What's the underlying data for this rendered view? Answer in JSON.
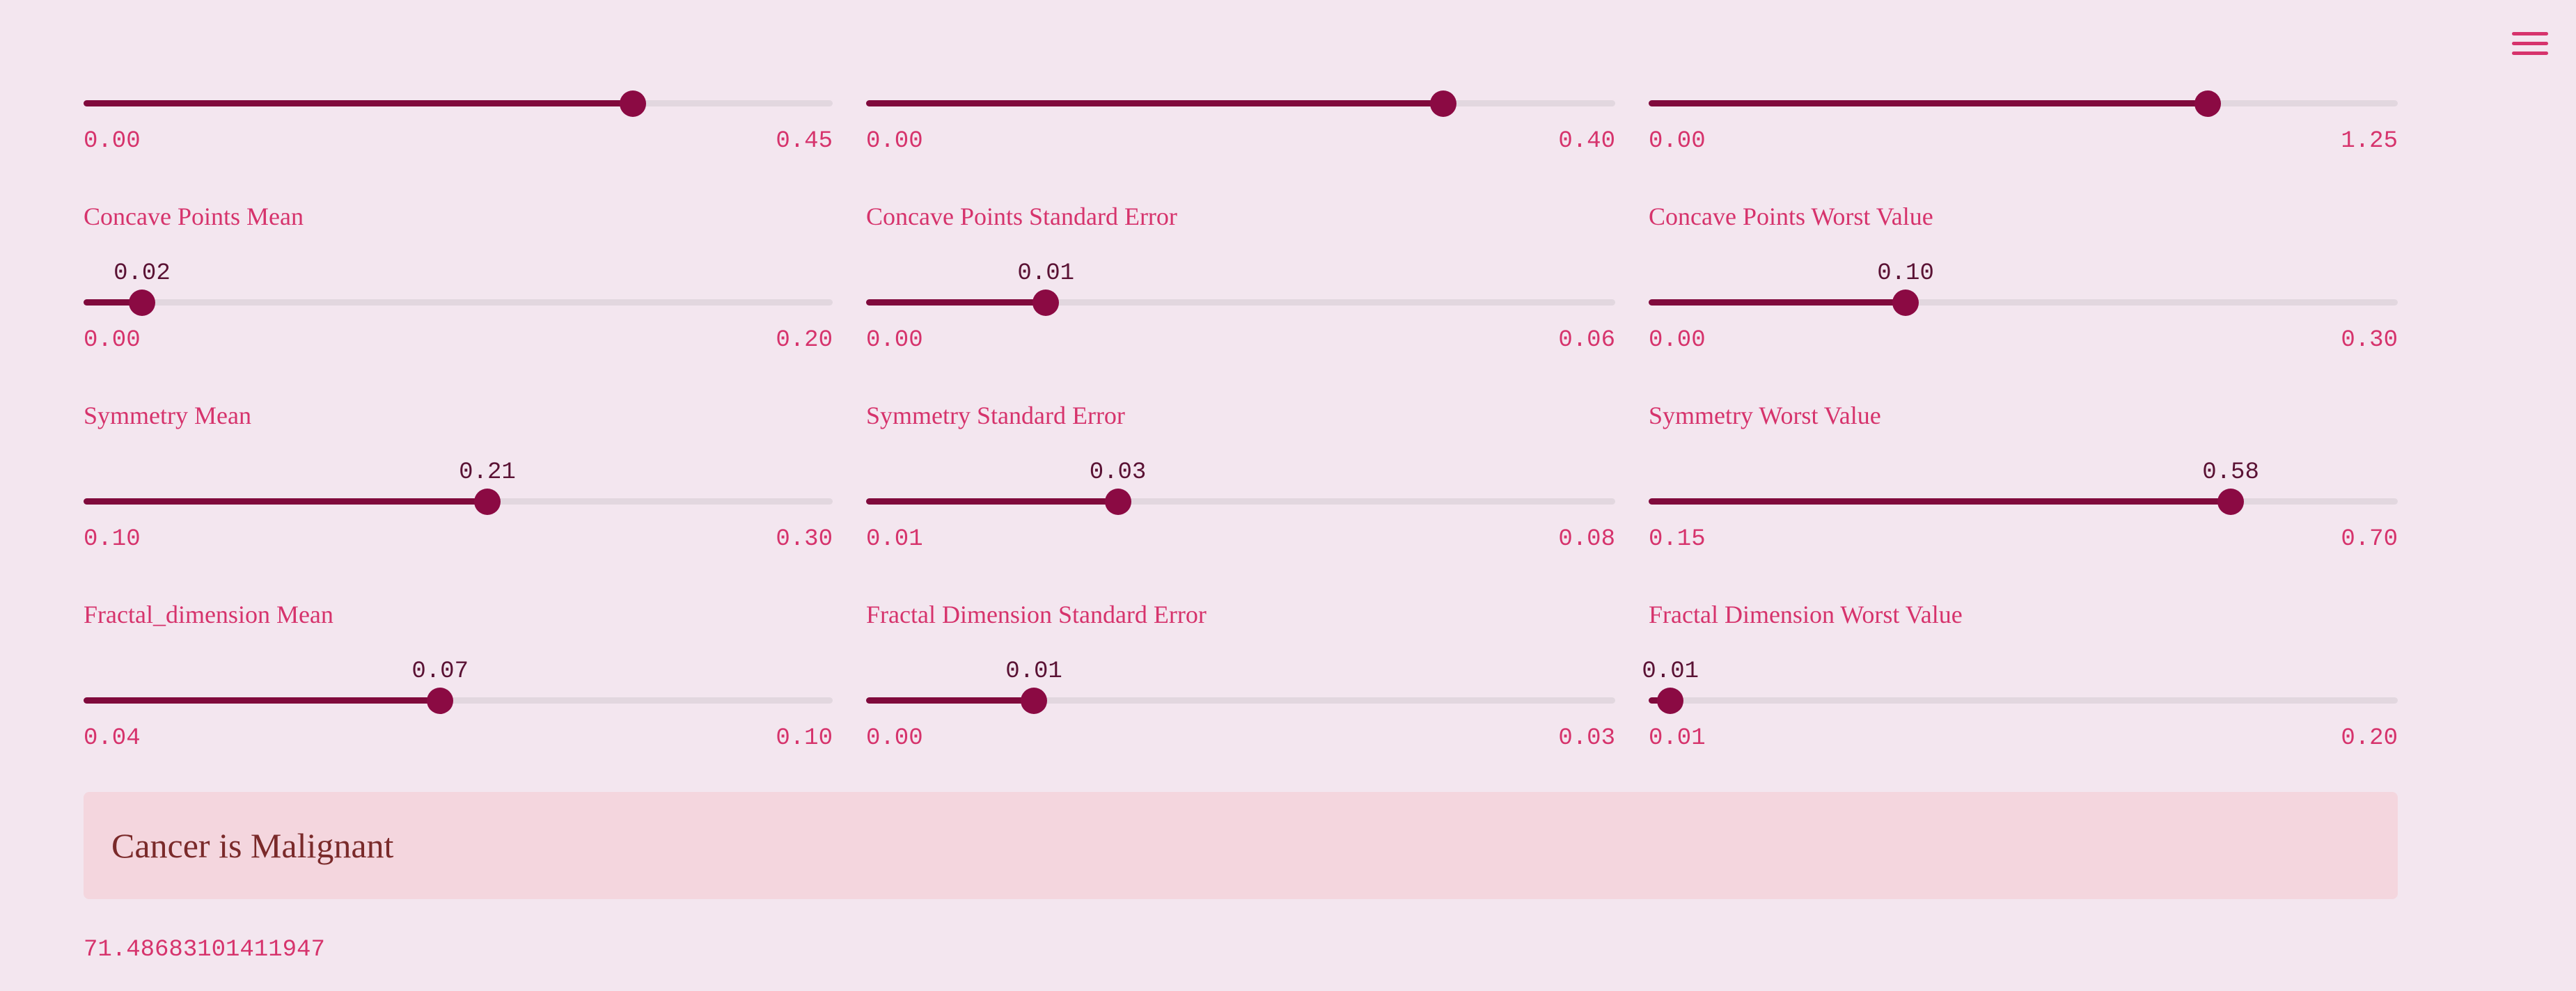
{
  "header": {
    "menu_icon": "hamburger-menu-icon"
  },
  "colors": {
    "background": "#f3e6ef",
    "accent": "#d6336c",
    "track_fill": "#800a3c",
    "track_empty": "#e2d7df",
    "result_background": "#f4d6de"
  },
  "sliders": [
    {
      "label": "",
      "value": "",
      "min": "0.00",
      "max": "0.45",
      "fraction": 0.733
    },
    {
      "label": "",
      "value": "",
      "min": "0.00",
      "max": "0.40",
      "fraction": 0.77
    },
    {
      "label": "",
      "value": "",
      "min": "0.00",
      "max": "1.25",
      "fraction": 0.746
    },
    {
      "label": "Concave Points Mean",
      "value": "0.02",
      "min": "0.00",
      "max": "0.20",
      "fraction": 0.078
    },
    {
      "label": "Concave Points Standard Error",
      "value": "0.01",
      "min": "0.00",
      "max": "0.06",
      "fraction": 0.24
    },
    {
      "label": "Concave Points Worst Value",
      "value": "0.10",
      "min": "0.00",
      "max": "0.30",
      "fraction": 0.343
    },
    {
      "label": "Symmetry Mean",
      "value": "0.21",
      "min": "0.10",
      "max": "0.30",
      "fraction": 0.539
    },
    {
      "label": "Symmetry Standard Error",
      "value": "0.03",
      "min": "0.01",
      "max": "0.08",
      "fraction": 0.336
    },
    {
      "label": "Symmetry Worst Value",
      "value": "0.58",
      "min": "0.15",
      "max": "0.70",
      "fraction": 0.777
    },
    {
      "label": "Fractal_dimension Mean",
      "value": "0.07",
      "min": "0.04",
      "max": "0.10",
      "fraction": 0.476
    },
    {
      "label": "Fractal Dimension Standard Error",
      "value": "0.01",
      "min": "0.00",
      "max": "0.03",
      "fraction": 0.224
    },
    {
      "label": "Fractal Dimension Worst Value",
      "value": "0.01",
      "min": "0.01",
      "max": "0.20",
      "fraction": 0.029
    }
  ],
  "result": {
    "text": "Cancer is Malignant",
    "score": "71.48683101411947"
  }
}
